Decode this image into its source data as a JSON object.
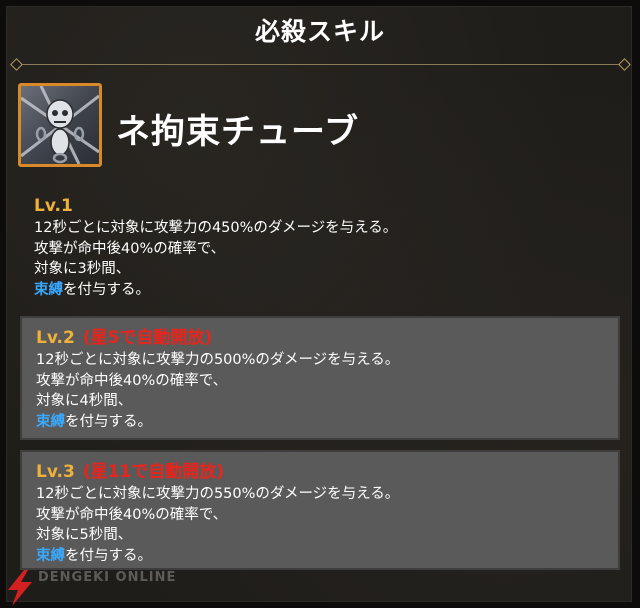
{
  "header": {
    "title": "必殺スキル"
  },
  "skill": {
    "name": "ネ拘束チューブ",
    "icon": "chained-skull-icon",
    "levels": [
      {
        "label": "Lv.1",
        "note": "",
        "lines": [
          "12秒ごとに対象に攻撃力の450%のダメージを与える。",
          "攻撃が命中後40%の確率で、",
          "対象に3秒間、"
        ],
        "keyword": "束縛",
        "suffix": "を付与する。"
      },
      {
        "label": "Lv.2",
        "note": "(星5で自動開放)",
        "lines": [
          "12秒ごとに対象に攻撃力の500%のダメージを与える。",
          "攻撃が命中後40%の確率で、",
          "対象に4秒間、"
        ],
        "keyword": "束縛",
        "suffix": "を付与する。"
      },
      {
        "label": "Lv.3",
        "note": "(星11で自動開放)",
        "lines": [
          "12秒ごとに対象に攻撃力の550%のダメージを与える。",
          "攻撃が命中後40%の確率で、",
          "対象に5秒間、"
        ],
        "keyword": "束縛",
        "suffix": "を付与する。"
      }
    ]
  },
  "colors": {
    "level_label": "#f0b13a",
    "unlock_note": "#e8241c",
    "keyword": "#39a9ff",
    "icon_border": "#d88a2a"
  },
  "watermark": {
    "brand": "DENGEKI ONLINE",
    "icon": "lightning-bolt-icon"
  }
}
